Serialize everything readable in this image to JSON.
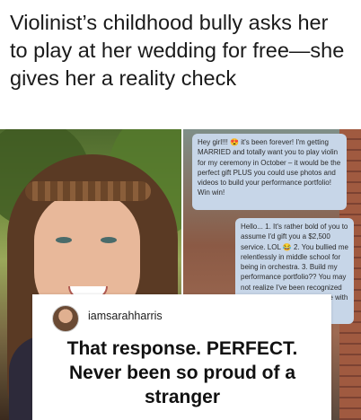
{
  "headline": "Violinist’s childhood bully asks her to play at her wedding for free—she gives her a reality check",
  "message_1": "Hey girl!!! 😍 it's been forever! I'm getting MARRIED and totally want you to play violin for my ceremony in October – it would be the perfect gift PLUS you could use photos and videos to build your performance portfolio! Win win!",
  "message_2": "Hello... 1. It's rather bold of you to assume I'd gift you a $2,500 service. LOL 😂 2. You bullied me relentlessly in middle school for being in orchestra. 3. Build my performance portfolio?? You may not realize I've been recognized by The Knot & Wedding Wire with \"...rtfolio\" ...n in the",
  "comment": {
    "username": "iamsarahharris",
    "text": "That response. PERFECT. Never been so proud of a stranger"
  },
  "colors": {
    "bubble": "#c7d6e8",
    "headline_text": "#1a1a1a"
  }
}
